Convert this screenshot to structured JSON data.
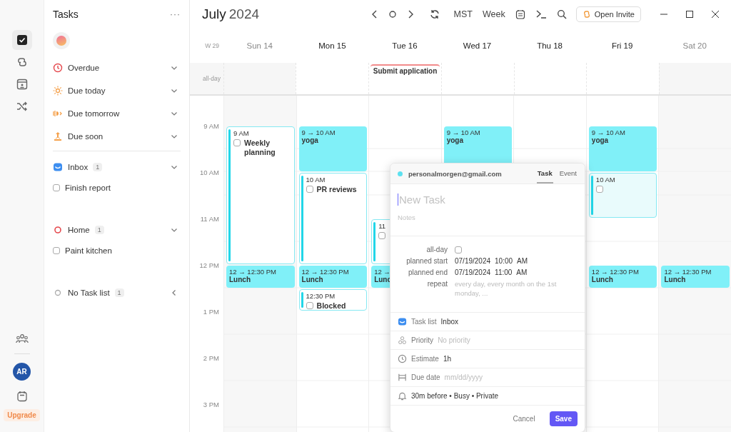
{
  "rail": {
    "items": [
      {
        "kind": "tasks",
        "selected": true
      },
      {
        "kind": "links",
        "selected": false
      },
      {
        "kind": "contacts",
        "selected": false
      },
      {
        "kind": "shuffle",
        "selected": false
      }
    ],
    "avatar": "AR",
    "upgrade": "Upgrade"
  },
  "task_panel": {
    "title": "Tasks",
    "menu": "···",
    "smart_lists": [
      {
        "kind": "overdue",
        "label": "Overdue",
        "expanded": true
      },
      {
        "kind": "today",
        "label": "Due today",
        "expanded": true
      },
      {
        "kind": "tomorrow",
        "label": "Due tomorrow",
        "expanded": true
      },
      {
        "kind": "soon",
        "label": "Due soon",
        "expanded": true
      }
    ],
    "lists": [
      {
        "kind": "inbox",
        "label": "Inbox",
        "count": "1",
        "expanded": true,
        "tasks": [
          {
            "title": "Finish report",
            "checked": false
          }
        ]
      },
      {
        "kind": "home",
        "label": "Home",
        "count": "1",
        "expanded": true,
        "tasks": [
          {
            "title": "Paint kitchen",
            "checked": false
          }
        ]
      },
      {
        "kind": "none",
        "label": "No Task list",
        "count": "1",
        "expanded": false
      }
    ]
  },
  "calendar": {
    "month": "July",
    "year": "2024",
    "timezone": "MST",
    "view": "Week",
    "invite": "Open Invite",
    "week": "W 29",
    "allday_label": "all-day",
    "hours": [
      "9 AM",
      "10 AM",
      "11 AM",
      "12 PM",
      "1 PM",
      "2 PM",
      "3 PM"
    ],
    "days": [
      {
        "label": "Sun 14",
        "weekend": true,
        "events": [
          {
            "kind": "task",
            "time": "9 AM",
            "title": "Weekly planning",
            "checked": false,
            "selected": false
          },
          {
            "kind": "event",
            "time": "12 → 12:30 PM",
            "title": "Lunch"
          }
        ]
      },
      {
        "label": "Mon 15",
        "weekend": false,
        "events": [
          {
            "kind": "event",
            "time": "9 → 10 AM",
            "title": "yoga"
          },
          {
            "kind": "task",
            "time": "10 AM",
            "title": "PR reviews",
            "checked": false,
            "selected": false
          },
          {
            "kind": "event",
            "time": "12 → 12:30 PM",
            "title": "Lunch"
          },
          {
            "kind": "task",
            "time": "12:30 PM",
            "title": "Blocked",
            "checked": false,
            "selected": false
          }
        ]
      },
      {
        "label": "Tue 16",
        "weekend": false,
        "all_day": [
          {
            "title": "Submit application"
          }
        ],
        "events": [
          {
            "kind": "task",
            "time": "11",
            "checked": false,
            "selected": false
          },
          {
            "kind": "event",
            "time": "12 →",
            "title": "Lunc"
          }
        ]
      },
      {
        "label": "Wed 17",
        "weekend": false,
        "events": [
          {
            "kind": "event",
            "time": "9 → 10 AM",
            "title": "yoga"
          }
        ]
      },
      {
        "label": "Thu 18",
        "weekend": false
      },
      {
        "label": "Fri 19",
        "weekend": false,
        "events": [
          {
            "kind": "event",
            "time": "9 → 10 AM",
            "title": "yoga"
          },
          {
            "kind": "task",
            "time": "10 AM",
            "checked": false,
            "selected": true
          },
          {
            "kind": "event",
            "time": "12 → 12:30 PM",
            "title": "Lunch"
          }
        ]
      },
      {
        "label": "Sat 20",
        "weekend": true,
        "events": [
          {
            "kind": "event",
            "time": "12 → 12:30 PM",
            "title": "Lunch"
          }
        ]
      }
    ]
  },
  "popup": {
    "account": "personalmorgen@gmail.com",
    "tabs": [
      {
        "label": "Task",
        "selected": true
      },
      {
        "label": "Event",
        "selected": false
      }
    ],
    "title": {
      "placeholder": "New Task"
    },
    "notes": {
      "placeholder": "Notes"
    },
    "fields": [
      {
        "kind": "checkbox",
        "label": "all-day",
        "checked": false
      },
      {
        "kind": "datetime",
        "label": "planned start",
        "date": "07/19/2024",
        "time": "10:00",
        "ampm": "AM"
      },
      {
        "kind": "datetime",
        "label": "planned end",
        "date": "07/19/2024",
        "time": "11:00",
        "ampm": "AM"
      },
      {
        "kind": "textarea",
        "label": "repeat",
        "placeholder": "every day, every month on the 1st monday, ..."
      }
    ],
    "properties": [
      {
        "kind": "tasklist",
        "label": "Task list",
        "value": "Inbox"
      },
      {
        "kind": "priority",
        "label": "Priority",
        "placeholder": "No priority"
      },
      {
        "kind": "estimate",
        "label": "Estimate",
        "value": "1h"
      },
      {
        "kind": "due",
        "label": "Due date",
        "placeholder": "mm/dd/yyyy"
      },
      {
        "kind": "reminder",
        "value": "30m before • Busy • Private"
      }
    ],
    "buttons": [
      {
        "kind": "secondary",
        "label": "Cancel"
      },
      {
        "kind": "primary",
        "label": "Save"
      }
    ]
  }
}
